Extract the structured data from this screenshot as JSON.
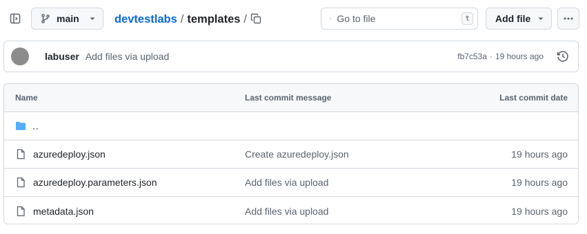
{
  "topbar": {
    "branch": "main",
    "breadcrumb": {
      "repo": "devtestlabs",
      "separator": "/",
      "dir": "templates",
      "trailing": "/"
    },
    "goto": {
      "placeholder": "Go to file",
      "shortcut": "t"
    },
    "add_file_label": "Add file",
    "icons": [
      "sidebar-expand-icon",
      "git-branch-icon",
      "chevron-down-icon",
      "copy-icon",
      "search-icon",
      "kebab-horizontal-icon"
    ]
  },
  "commit": {
    "user": "labuser",
    "message": "Add files via upload",
    "sha": "fb7c53a",
    "dot": "·",
    "time": "19 hours ago"
  },
  "table": {
    "headers": {
      "name": "Name",
      "message": "Last commit message",
      "date": "Last commit date"
    },
    "parent": "..",
    "files": [
      {
        "name": "azuredeploy.json",
        "message": "Create azuredeploy.json",
        "date": "19 hours ago"
      },
      {
        "name": "azuredeploy.parameters.json",
        "message": "Add files via upload",
        "date": "19 hours ago"
      },
      {
        "name": "metadata.json",
        "message": "Add files via upload",
        "date": "19 hours ago"
      }
    ]
  },
  "colors": {
    "link": "#0969da",
    "folder": "#54aeff",
    "muted": "#59636e",
    "border": "#d1d9e0",
    "header_bg": "#f6f8fa"
  }
}
